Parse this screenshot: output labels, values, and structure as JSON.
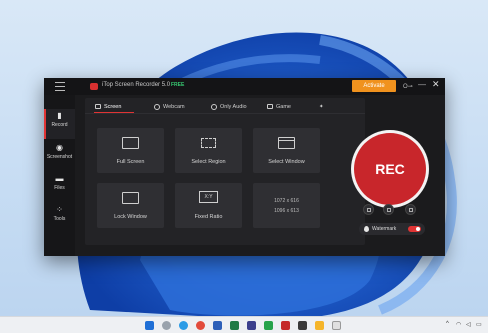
{
  "app": {
    "title": "iTop Screen Recorder 5.0",
    "badge": "FREE",
    "activate_label": "Activate",
    "accent_color": "#e03434",
    "activate_color": "#f0921e",
    "icons": {
      "menu": "hamburger-icon",
      "key": "key-icon",
      "minimize": "minimize-icon",
      "close": "close-icon"
    }
  },
  "sidebar": {
    "items": [
      {
        "label": "Record",
        "icon": "record-icon",
        "active": true
      },
      {
        "label": "Screenshot",
        "icon": "camera-icon",
        "active": false
      },
      {
        "label": "Files",
        "icon": "folder-icon",
        "active": false
      },
      {
        "label": "Tools",
        "icon": "grid-icon",
        "active": false
      }
    ]
  },
  "tabs": [
    {
      "label": "Screen",
      "icon": "monitor-icon",
      "active": true
    },
    {
      "label": "Webcam",
      "icon": "webcam-icon",
      "active": false
    },
    {
      "label": "Only Audio",
      "icon": "audio-icon",
      "active": false
    },
    {
      "label": "Game",
      "icon": "gamepad-icon",
      "active": false
    }
  ],
  "modes": {
    "full_screen": "Full Screen",
    "select_region": "Select Region",
    "select_window": "Select Window",
    "lock_window": "Lock Window",
    "fixed_ratio": "Fixed Ratio",
    "xy_label": "X:Y",
    "res_1": "1072 x 616",
    "res_2": "1096 x 613"
  },
  "record": {
    "label": "REC",
    "watermark_label": "Watermark",
    "watermark_on": true
  },
  "taskbar": {
    "pinned": [
      "windows-icon",
      "search-icon",
      "edge-icon",
      "chrome-icon",
      "word-icon",
      "excel-icon",
      "app-icon",
      "app-icon",
      "app-icon",
      "app-icon",
      "app-icon",
      "app-icon",
      "app-icon"
    ],
    "tray_text": "^"
  }
}
